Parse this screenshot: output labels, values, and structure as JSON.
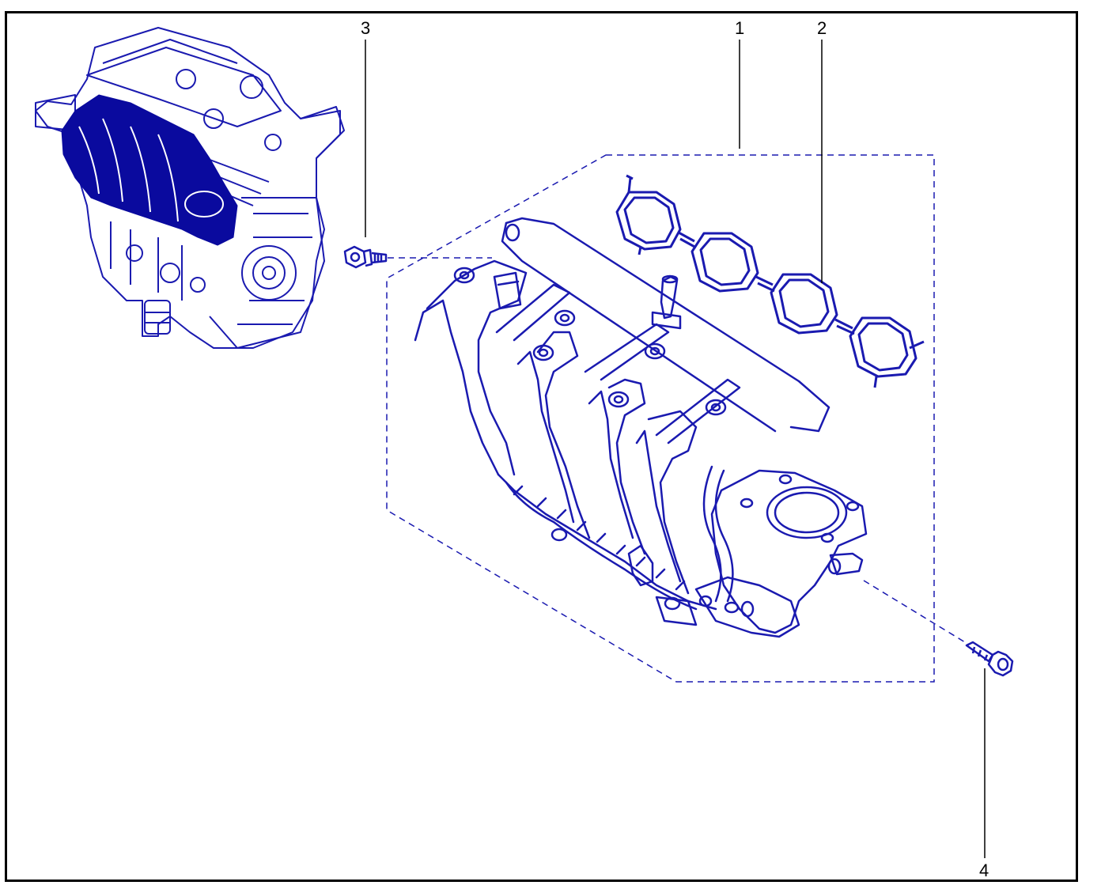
{
  "callouts": [
    {
      "id": "1",
      "label": "1"
    },
    {
      "id": "2",
      "label": "2"
    },
    {
      "id": "3",
      "label": "3"
    },
    {
      "id": "4",
      "label": "4"
    }
  ],
  "colors": {
    "line_art": "#1a1ab0",
    "engine_fill": "#0a0a9e",
    "leader": "#000000",
    "frame": "#000000",
    "background": "#ffffff"
  }
}
